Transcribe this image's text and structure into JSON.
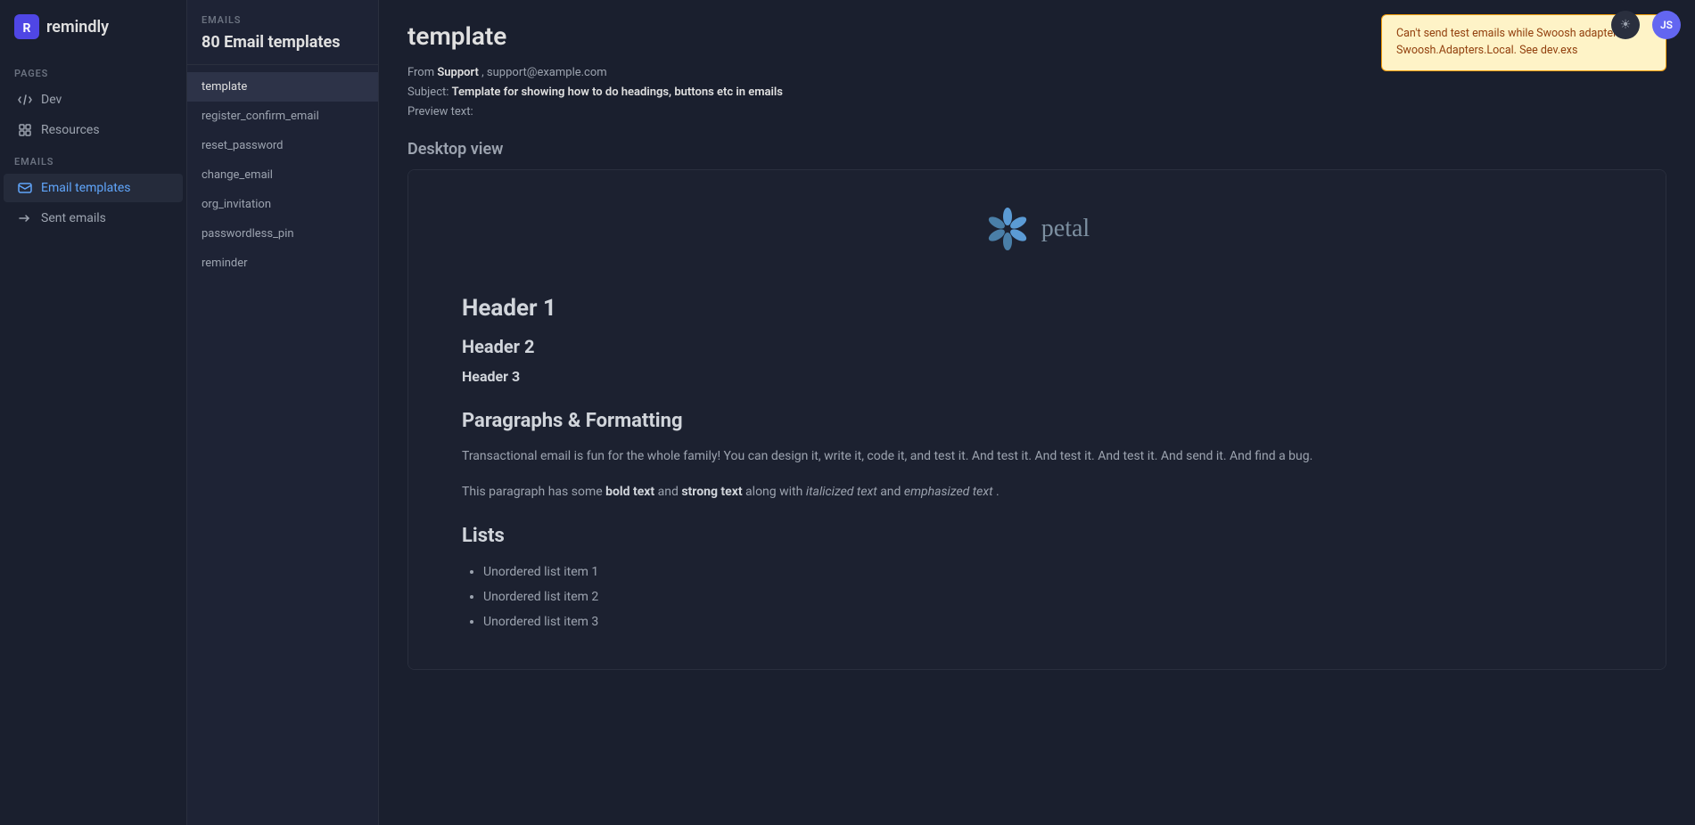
{
  "app": {
    "name": "Remindly",
    "logo_text": "remindly"
  },
  "topbar": {
    "theme_icon": "☀",
    "avatar_initials": "JS"
  },
  "sidebar": {
    "pages_label": "PAGES",
    "pages_items": [
      {
        "id": "dev",
        "label": "Dev",
        "icon": "dev-icon"
      },
      {
        "id": "resources",
        "label": "Resources",
        "icon": "resources-icon"
      }
    ],
    "emails_label": "EMAILS",
    "emails_items": [
      {
        "id": "email-templates",
        "label": "Email templates",
        "icon": "email-templates-icon",
        "active": true
      },
      {
        "id": "sent-emails",
        "label": "Sent emails",
        "icon": "sent-emails-icon"
      }
    ]
  },
  "email_list": {
    "section_label": "EMAILS",
    "count_label": "80 Email templates",
    "items": [
      {
        "id": "template",
        "label": "template",
        "active": true
      },
      {
        "id": "register_confirm_email",
        "label": "register_confirm_email"
      },
      {
        "id": "reset_password",
        "label": "reset_password"
      },
      {
        "id": "change_email",
        "label": "change_email"
      },
      {
        "id": "org_invitation",
        "label": "org_invitation"
      },
      {
        "id": "passwordless_pin",
        "label": "passwordless_pin"
      },
      {
        "id": "reminder",
        "label": "reminder"
      }
    ]
  },
  "main": {
    "title": "template",
    "from_label": "From",
    "from_bold": "Support",
    "from_email": ", support@example.com",
    "subject_label": "Subject:",
    "subject_bold": "Template for showing how to do headings, buttons etc in emails",
    "preview_label": "Preview text:",
    "preview_value": "",
    "warning": {
      "text": "Can't send test emails while Swoosh adapter is Swoosh.Adapters.Local. See dev.exs"
    },
    "desktop_view_label": "Desktop view",
    "email_preview": {
      "logo_text": "petal",
      "h1": "Header 1",
      "h2": "Header 2",
      "h3": "Header 3",
      "paragraphs_heading": "Paragraphs & Formatting",
      "paragraph1": "Transactional email is fun for the whole family! You can design it, write it, code it, and test it. And test it. And test it. And test it. And send it. And find a bug.",
      "paragraph2_before": "This paragraph has some ",
      "paragraph2_bold1": "bold text",
      "paragraph2_mid": " and ",
      "paragraph2_bold2": "strong text",
      "paragraph2_after": " along with ",
      "paragraph2_em1": "italicized text",
      "paragraph2_and": " and ",
      "paragraph2_em2": "emphasized text",
      "paragraph2_end": " .",
      "lists_heading": "Lists",
      "list_items": [
        "Unordered list item 1",
        "Unordered list item 2",
        "Unordered list item 3"
      ]
    }
  }
}
